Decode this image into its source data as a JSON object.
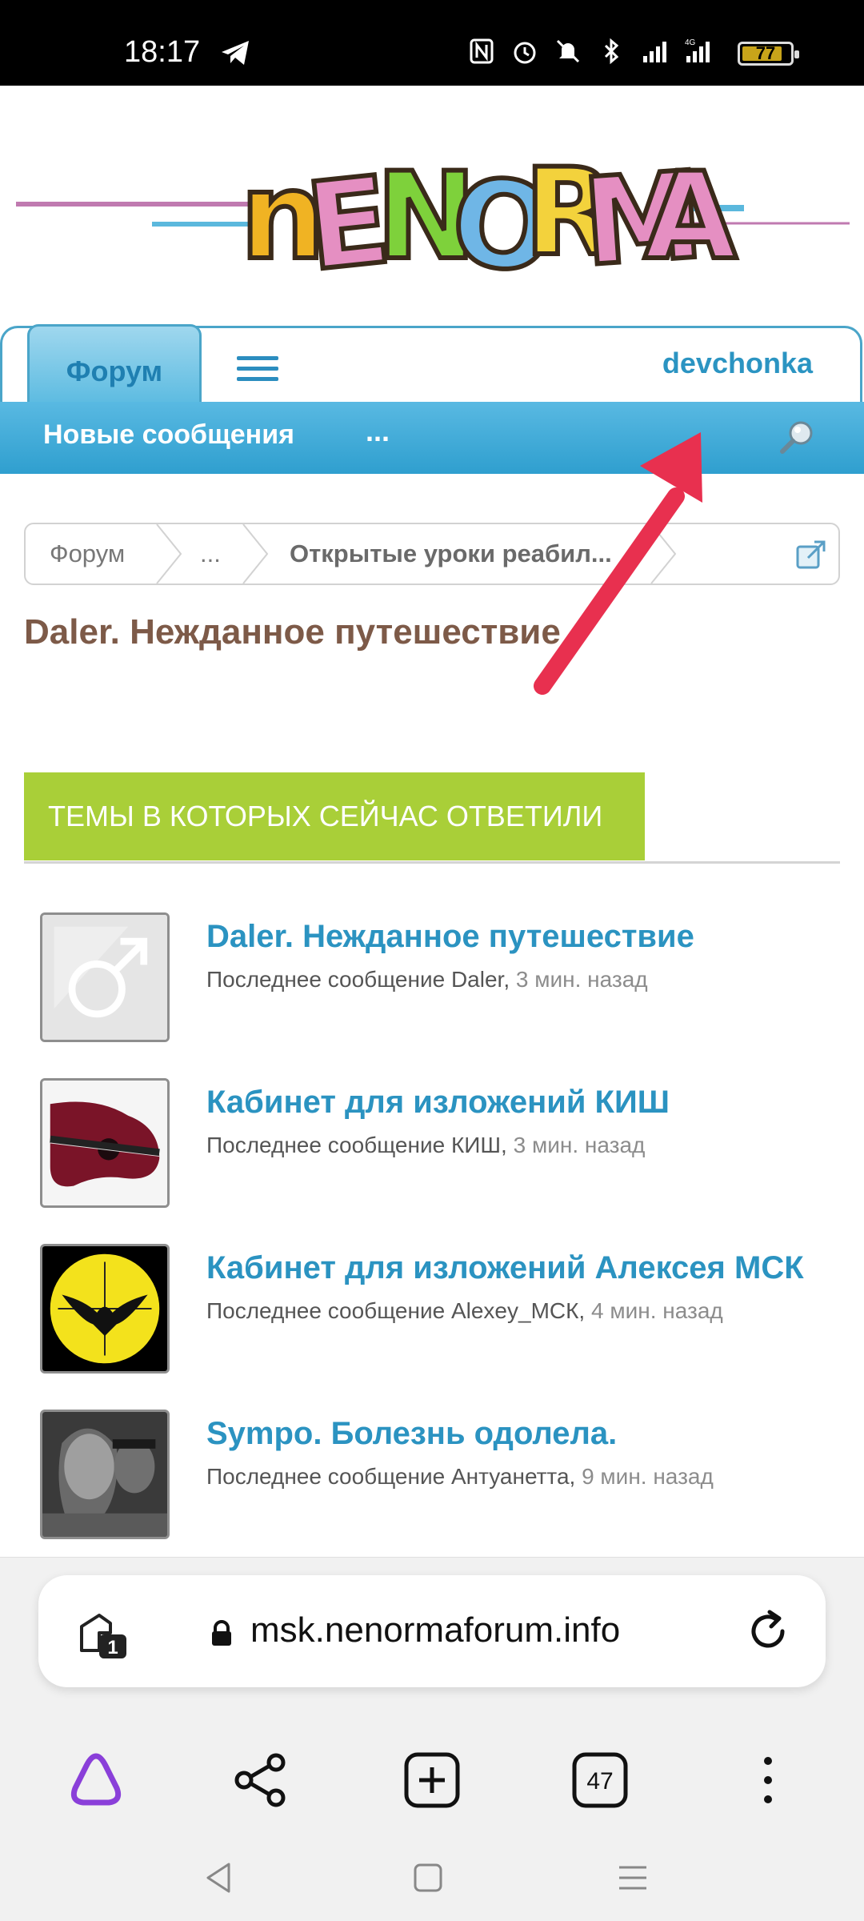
{
  "status_bar": {
    "time": "18:17",
    "battery": "77",
    "icons": [
      "telegram-icon",
      "nfc-icon",
      "alarm-icon",
      "mute-icon",
      "bluetooth-icon",
      "signal-icon",
      "4g-signal-icon",
      "battery-icon"
    ]
  },
  "header": {
    "logo_text": "NENORMA"
  },
  "nav": {
    "forum_tab": "Форум",
    "username": "devchonka",
    "new_messages": "Новые сообщения",
    "more": "..."
  },
  "breadcrumb": {
    "items": [
      "Форум",
      "...",
      "Открытые уроки реабил..."
    ]
  },
  "thread_title": "Daler. Нежданное путешествие",
  "section": {
    "heading": "ТЕМЫ В КОТОРЫХ СЕЙЧАС ОТВЕТИЛИ"
  },
  "topics": [
    {
      "title": "Daler. Нежданное путешествие",
      "meta": "Последнее сообщение Daler,",
      "time": "3 мин. назад",
      "avatar": "male-symbol-avatar"
    },
    {
      "title": "Кабинет для изложений КИШ",
      "meta": "Последнее сообщение КИШ,",
      "time": "3 мин. назад",
      "avatar": "guitar-avatar"
    },
    {
      "title": "Кабинет для изложений Алексея МСК",
      "meta": "Последнее сообщение Alexey_МСК,",
      "time": "4 мин. назад",
      "avatar": "bat-target-avatar"
    },
    {
      "title": "Sympo. Болезнь одолела.",
      "meta": "Последнее сообщение Антуанетта,",
      "time": "9 мин. назад",
      "avatar": "photo-avatar"
    }
  ],
  "browser": {
    "tab_count_badge": "1",
    "url": "msk.nenormaforum.info",
    "open_tabs": "47"
  },
  "colors": {
    "accent_blue": "#2b93c1",
    "section_green": "#a9cf38",
    "title_brown": "#7d5a48",
    "arrow_red": "#e8304f"
  }
}
